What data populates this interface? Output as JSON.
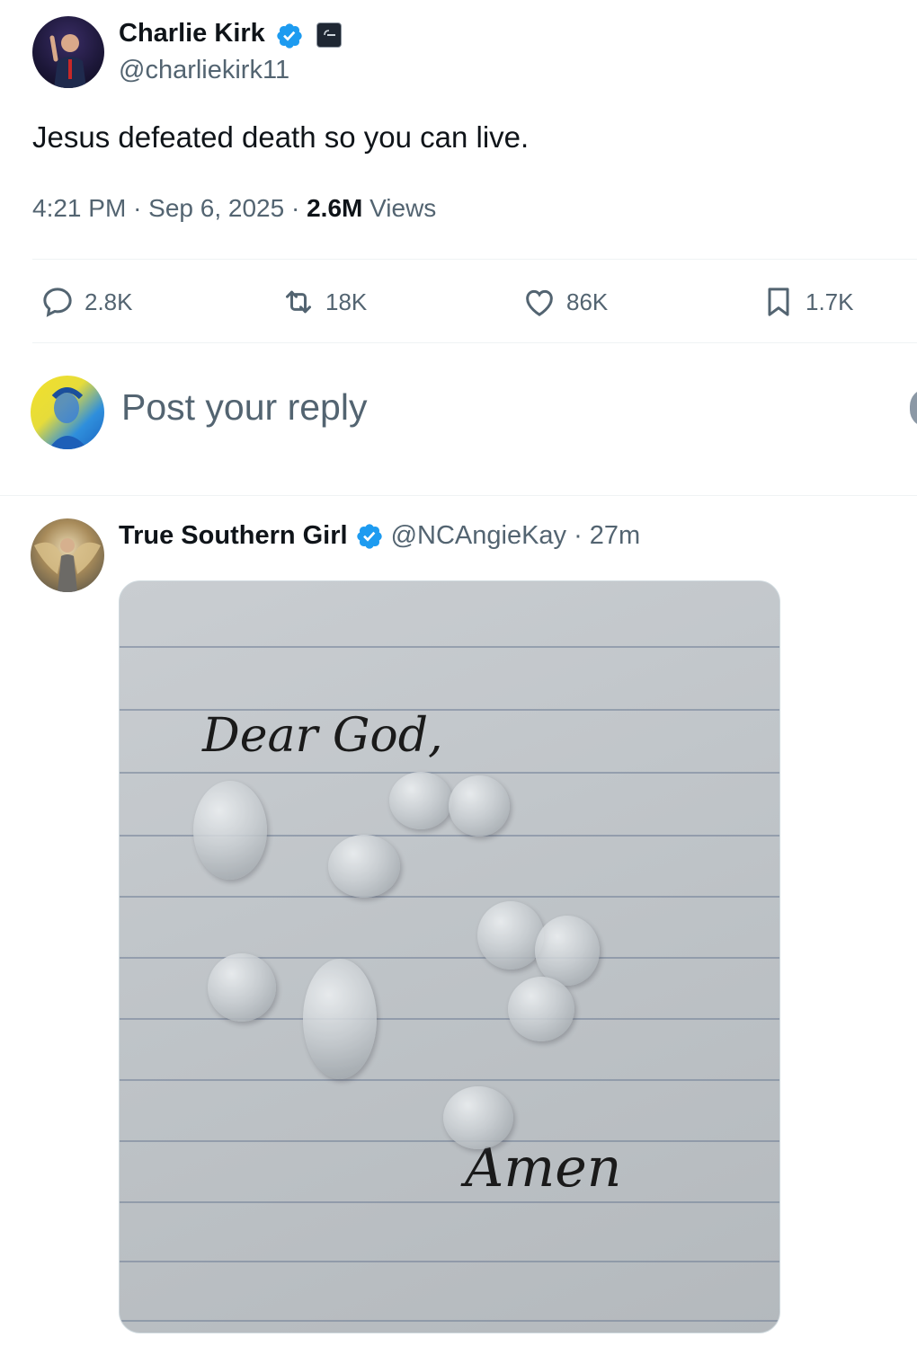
{
  "post": {
    "author_name": "Charlie Kirk",
    "author_handle": "@charliekirk11",
    "text": "Jesus defeated death so you can live.",
    "time": "4:21 PM",
    "date": "Sep 6, 2025",
    "views_count": "2.6M",
    "views_label": "Views",
    "separator": "·",
    "actions": {
      "replies": "2.8K",
      "reposts": "18K",
      "likes": "86K",
      "bookmarks": "1.7K"
    }
  },
  "reply_box": {
    "placeholder": "Post your reply"
  },
  "reply": {
    "author_name": "True Southern Girl",
    "author_handle": "@NCAngieKay",
    "age": "· 27m",
    "image": {
      "handwriting_top": "Dear God,",
      "handwriting_bottom": "Amen"
    }
  },
  "colors": {
    "verified": "#1d9bf0",
    "text_primary": "#0f1419",
    "text_secondary": "#536471",
    "divider": "#eff3f4"
  },
  "icons": [
    "verified-badge-icon",
    "affiliate-badge-icon",
    "reply-icon",
    "repost-icon",
    "like-icon",
    "bookmark-icon"
  ]
}
